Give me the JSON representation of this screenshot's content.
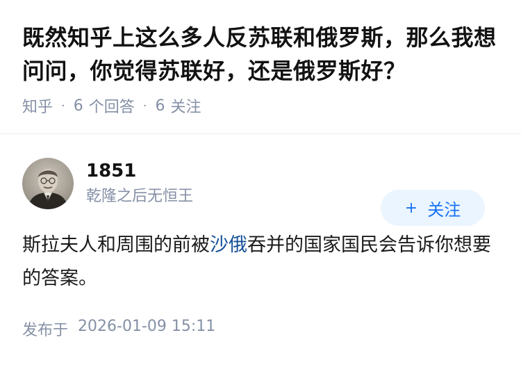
{
  "question": {
    "title": "既然知乎上这么多人反苏联和俄罗斯，那么我想问问，你觉得苏联好，还是俄罗斯好？",
    "source": "知乎",
    "answer_count": "6",
    "answer_label": "个回答",
    "follow_count": "6",
    "follow_label": "关注",
    "separator": "·"
  },
  "answer": {
    "author_name": "1851",
    "author_bio": "乾隆之后无恒王",
    "follow_button": {
      "icon": "+",
      "label": "关注"
    },
    "content_before": "斯拉夫人和周围的前被",
    "content_link": "沙俄",
    "content_after": "吞并的国家国民会告诉你想要的答案。",
    "publish_label": "发布于",
    "publish_time": "2026-01-09 15:11"
  },
  "colors": {
    "accent": "#1772f6",
    "link": "#175199",
    "meta_gray": "#8590a6",
    "follow_bg": "#ebf5ff"
  }
}
